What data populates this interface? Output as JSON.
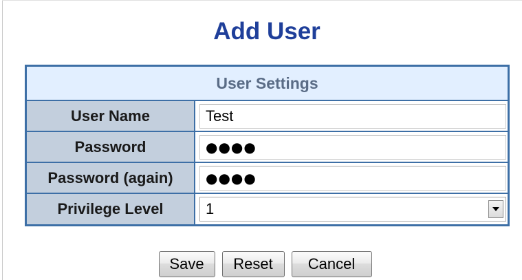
{
  "page": {
    "title": "Add User"
  },
  "user_settings": {
    "header": "User Settings",
    "fields": {
      "user_name": {
        "label": "User Name",
        "value": "Test"
      },
      "password": {
        "label": "Password",
        "value": "●●●●"
      },
      "password_again": {
        "label": "Password (again)",
        "value": "●●●●"
      },
      "privilege_level": {
        "label": "Privilege Level",
        "value": "1"
      }
    }
  },
  "buttons": {
    "save": "Save",
    "reset": "Reset",
    "cancel": "Cancel"
  },
  "colors": {
    "title": "#1f3f9a",
    "table_border": "#3d6fa6",
    "header_bg": "#e2efff",
    "label_bg": "#c3cfdd"
  },
  "icons": {
    "dropdown": "chevron-down-icon"
  }
}
